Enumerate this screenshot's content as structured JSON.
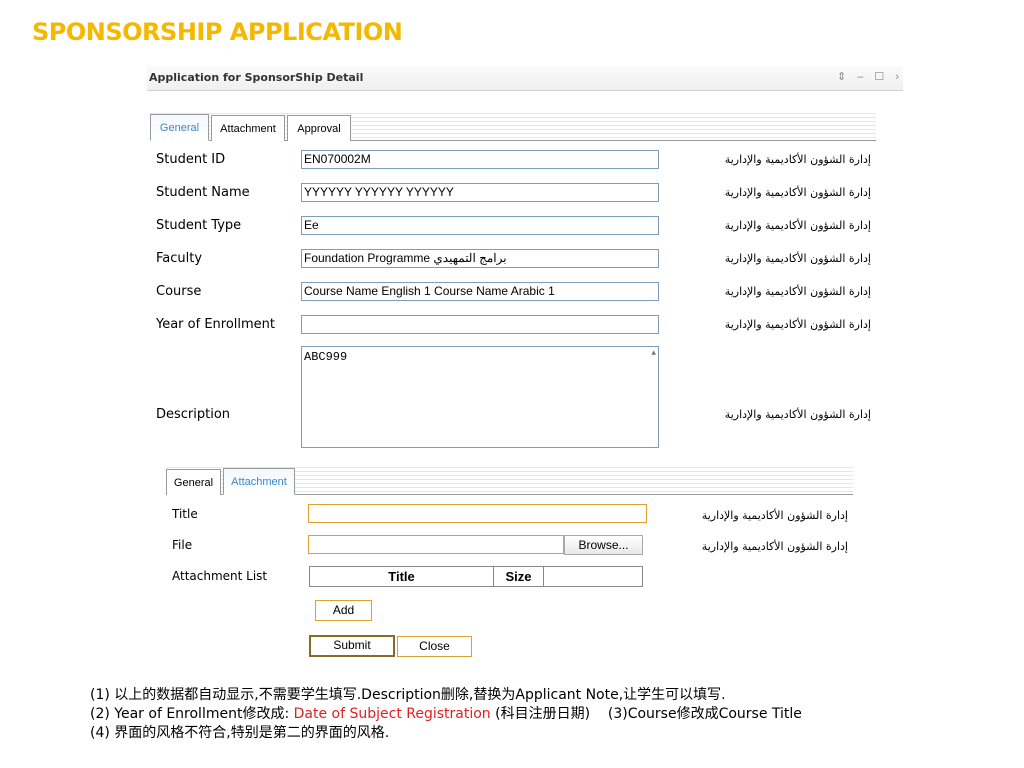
{
  "slide_title": "SPONSORSHIP APPLICATION",
  "window": {
    "title": "Application for SponsorShip Detail",
    "controls": "⇕ – ☐ ›"
  },
  "tabs_main": [
    "General",
    "Attachment",
    "Approval"
  ],
  "form": {
    "rows": [
      {
        "label": "Student ID",
        "value": "EN070002M",
        "arabic": "إدارة الشؤون الأكاديمية والإدارية"
      },
      {
        "label": "Student Name",
        "value": "YYYYYY YYYYYY YYYYYY",
        "arabic": "إدارة الشؤون الأكاديمية والإدارية"
      },
      {
        "label": "Student Type",
        "value": "Ee",
        "arabic": "إدارة الشؤون الأكاديمية والإدارية"
      },
      {
        "label": "Faculty",
        "value": "Foundation Programme برامج التمهيدي",
        "arabic": "إدارة الشؤون الأكاديمية والإدارية"
      },
      {
        "label": "Course",
        "value": "Course Name English 1 Course Name Arabic 1",
        "arabic": "إدارة الشؤون الأكاديمية والإدارية"
      },
      {
        "label": "Year of Enrollment",
        "value": "",
        "arabic": "إدارة الشؤون الأكاديمية والإدارية"
      }
    ],
    "description": {
      "label": "Description",
      "value": "ABC999",
      "arabic": "إدارة الشؤون الأكاديمية والإدارية"
    }
  },
  "tabs_attach": [
    "General",
    "Attachment"
  ],
  "attach": {
    "title_label": "Title",
    "title_arabic": "إدارة الشؤون الأكاديمية والإدارية",
    "file_label": "File",
    "browse_label": "Browse...",
    "file_arabic": "إدارة الشؤون الأكاديمية والإدارية",
    "list_label": "Attachment List",
    "columns": [
      "Title",
      "Size"
    ],
    "add_label": "Add",
    "submit_label": "Submit",
    "close_label": "Close"
  },
  "notes": {
    "line1": "(1) 以上的数据都自动显示,不需要学生填写.Description删除,替换为Applicant Note,让学生可以填写.",
    "line2_a": "(2) Year of Enrollment修改成: ",
    "line2_red": "Date of Subject Registration",
    "line2_b": " (科目注册日期)    (3)Course修改成Course Title",
    "line3": "(4) 界面的风格不符合,特别是第二的界面的风格."
  },
  "colors": {
    "title": "#f5b800",
    "active_tab": "#3a86c8",
    "note_red": "#e02020",
    "field_border_attach": "#e0a030"
  }
}
